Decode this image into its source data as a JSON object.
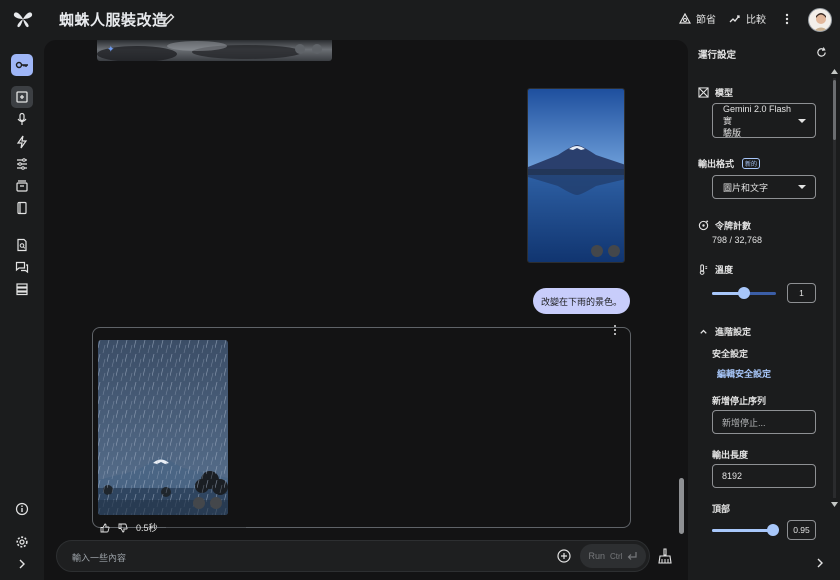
{
  "app": {
    "title": "蜘蛛人服裝改造",
    "top_actions": [
      {
        "label": "節省",
        "icon": "savings-icon"
      },
      {
        "label": "比較",
        "icon": "compare-icon"
      }
    ]
  },
  "sidebar": {
    "items": [
      {
        "name": "api-key",
        "icon": "key-icon",
        "active": true
      },
      {
        "name": "chat-prompt",
        "icon": "chat-add-icon",
        "selected": true
      },
      {
        "name": "stream",
        "icon": "mic-icon"
      },
      {
        "name": "starter-apps",
        "icon": "bolt-icon"
      },
      {
        "name": "tune",
        "icon": "tune-icon"
      },
      {
        "name": "library",
        "icon": "inventory-icon"
      },
      {
        "name": "docs",
        "icon": "book-icon"
      },
      {
        "name": "search-docs",
        "icon": "doc-search-icon"
      },
      {
        "name": "feedback",
        "icon": "feedback-icon"
      },
      {
        "name": "storage",
        "icon": "storage-icon"
      }
    ],
    "bottom": [
      {
        "name": "info",
        "icon": "info-icon"
      },
      {
        "name": "settings",
        "icon": "gear-icon"
      },
      {
        "name": "expand",
        "icon": "chevron-right-icon"
      }
    ]
  },
  "chat": {
    "user_message": "改變在下雨的景色。",
    "response_time": "0.5秒",
    "input_placeholder": "輸入一些內容",
    "run_label": "Run",
    "run_shortcut": "Ctrl"
  },
  "run_settings": {
    "title": "運行設定",
    "model": {
      "label": "模型",
      "value_line1": "Gemini 2.0 Flash 實",
      "value_line2": "驗版"
    },
    "output_format": {
      "label": "輸出格式",
      "badge": "新的",
      "value": "圖片和文字"
    },
    "token_count": {
      "label": "令牌計數",
      "value": "798 / 32,768"
    },
    "temperature": {
      "label": "溫度",
      "value": "1",
      "level": 0.5
    },
    "advanced": {
      "label": "進階設定",
      "safety_label": "安全設定",
      "safety_link": "編輯安全設定",
      "stop_label": "新增停止序列",
      "stop_placeholder": "新增停止...",
      "length_label": "輸出長度",
      "length_value": "8192",
      "top_p_label": "頂部",
      "top_p_value": "0.95",
      "top_p_level": 0.95
    }
  }
}
